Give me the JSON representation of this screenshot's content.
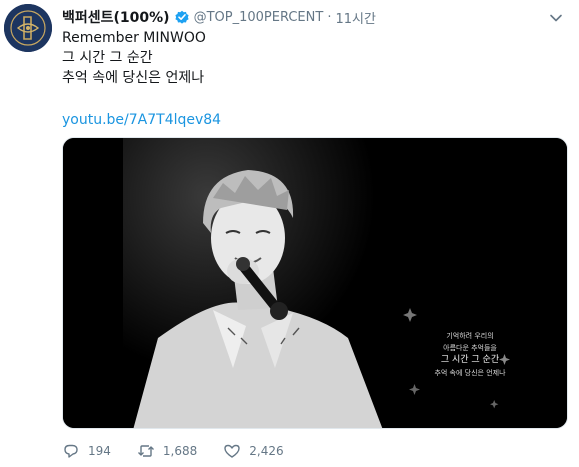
{
  "tweet": {
    "display_name": "백퍼센트(100%)",
    "handle": "@TOP_100PERCENT",
    "separator": "·",
    "time": "11시간",
    "lines": [
      "Remember MINWOO",
      "그 시간 그 순간",
      "추억 속에 당신은 언제나"
    ],
    "link": "youtu.be/7A7T4lqev84"
  },
  "media": {
    "caption_lines": [
      "기억하려 우리의",
      "아름다운 추억들을",
      "그 시간 그 순간",
      "추억 속에 당신은 언제나"
    ]
  },
  "actions": {
    "replies": "194",
    "retweets": "1,688",
    "likes": "2,426"
  },
  "icons": [
    "avatar-logo",
    "verified-badge-icon",
    "chevron-down-icon",
    "reply-icon",
    "retweet-icon",
    "like-icon"
  ],
  "colors": {
    "link": "#1b95e0",
    "verified": "#1da1f2",
    "secondary_text": "#657786",
    "avatar_bg": "#1d3560"
  }
}
